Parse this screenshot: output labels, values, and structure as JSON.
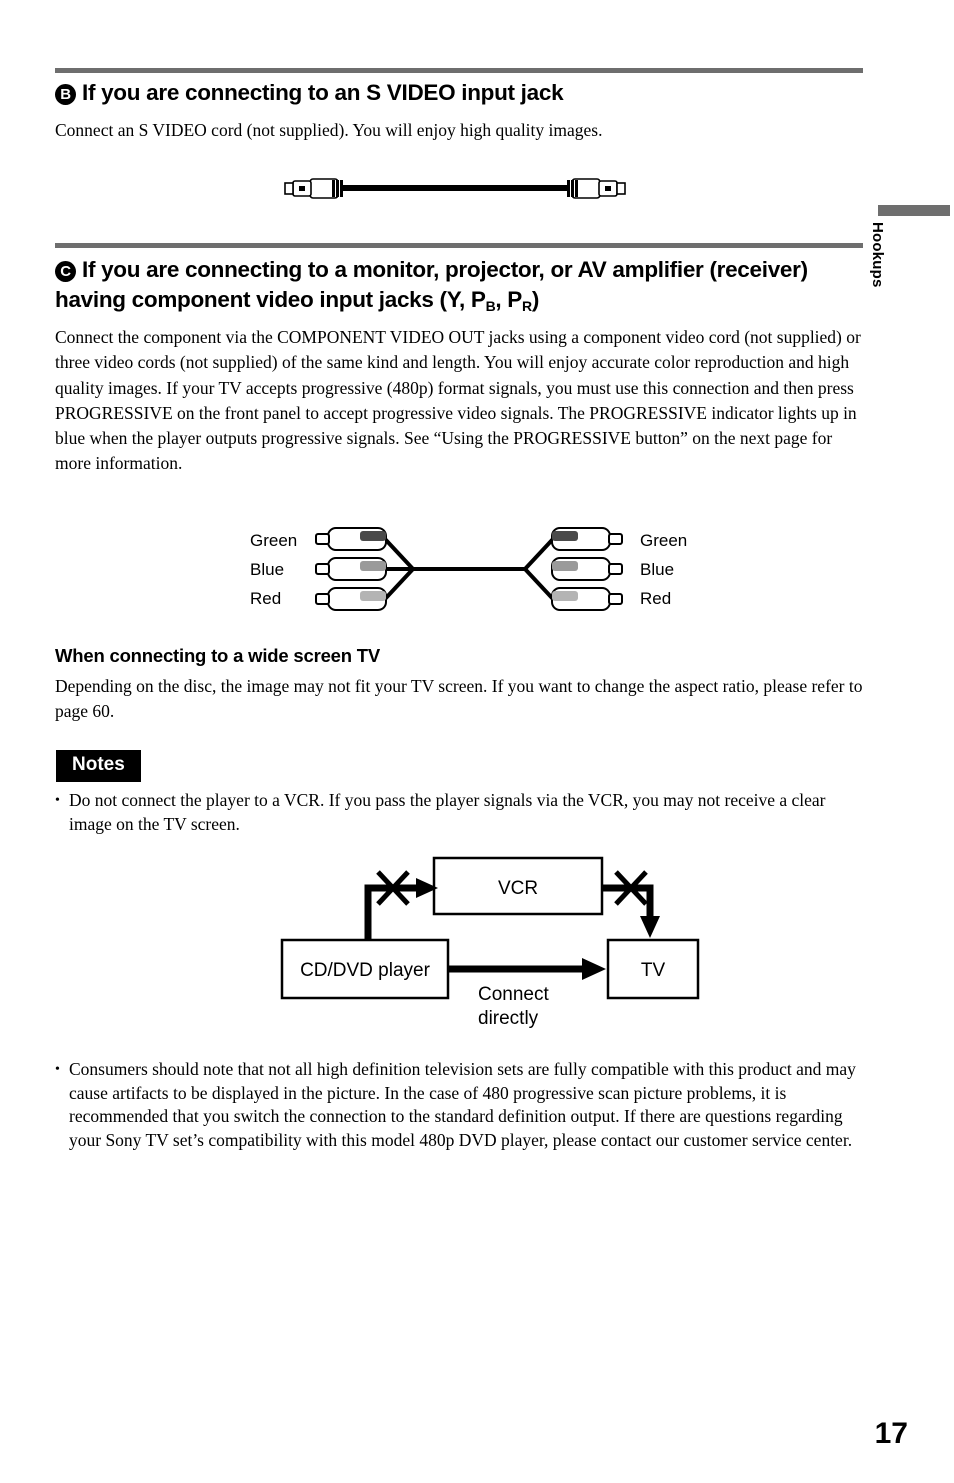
{
  "page": {
    "number": "17",
    "side_tab": "Hookups"
  },
  "section_b": {
    "marker": "B",
    "title": "If you are connecting to an S VIDEO input jack",
    "paragraph": "Connect an S VIDEO cord (not supplied). You will enjoy high quality images.",
    "diagram_name": "s-video-cable-illustration"
  },
  "section_c": {
    "marker": "C",
    "title_line1": "If you are connecting to a monitor, projector, or AV amplifier (receiver)",
    "title_line2_pre": "having component video input jacks (Y, P",
    "title_sub1": "B",
    "title_mid": ", P",
    "title_sub2": "R",
    "title_post": ")",
    "paragraph": "Connect the component via the COMPONENT VIDEO OUT jacks using a component video cord (not supplied) or three video cords (not supplied) of the same kind and length. You will enjoy accurate color reproduction and high quality images. If your TV accepts progressive (480p) format signals, you must use this connection and then press PROGRESSIVE on the front panel to accept progressive video signals. The PROGRESSIVE indicator lights up in blue when the player outputs progressive signals. See “Using the PROGRESSIVE button” on the next page for more information.",
    "cable_diagram": {
      "left_labels": [
        "Green",
        "Blue",
        "Red"
      ],
      "right_labels": [
        "Green",
        "Blue",
        "Red"
      ],
      "band_colors": [
        "#4a4a4a",
        "#9a9a9a",
        "#b4b4b4"
      ]
    }
  },
  "widescreen": {
    "heading": "When connecting to a wide screen TV",
    "paragraph": "Depending on the disc, the image may not fit your TV screen. If you want to change the aspect ratio, please refer to page 60."
  },
  "notes": {
    "badge": "Notes",
    "items": [
      "Do not connect the player to a VCR. If you pass the player signals via the VCR, you may not receive a clear image on the TV screen.",
      "Consumers should note that not all high definition television sets are fully compatible with this product and may cause artifacts to be displayed in the picture. In the case of 480 progressive scan picture problems, it is recommended that you switch the connection to the standard definition output. If there are questions regarding your Sony TV set’s compatibility with this model 480p DVD player, please contact our customer service center."
    ],
    "bullet_glyph": "•"
  },
  "vcr_diagram": {
    "vcr_label": "VCR",
    "player_label": "CD/DVD player",
    "tv_label": "TV",
    "connect_line1": "Connect",
    "connect_line2": "directly",
    "forbidden_marker": "x-cross-mark",
    "forbidden_count": 2
  },
  "colors": {
    "rule_gray": "#6e6e6e",
    "ink": "#000000",
    "paper": "#ffffff"
  }
}
